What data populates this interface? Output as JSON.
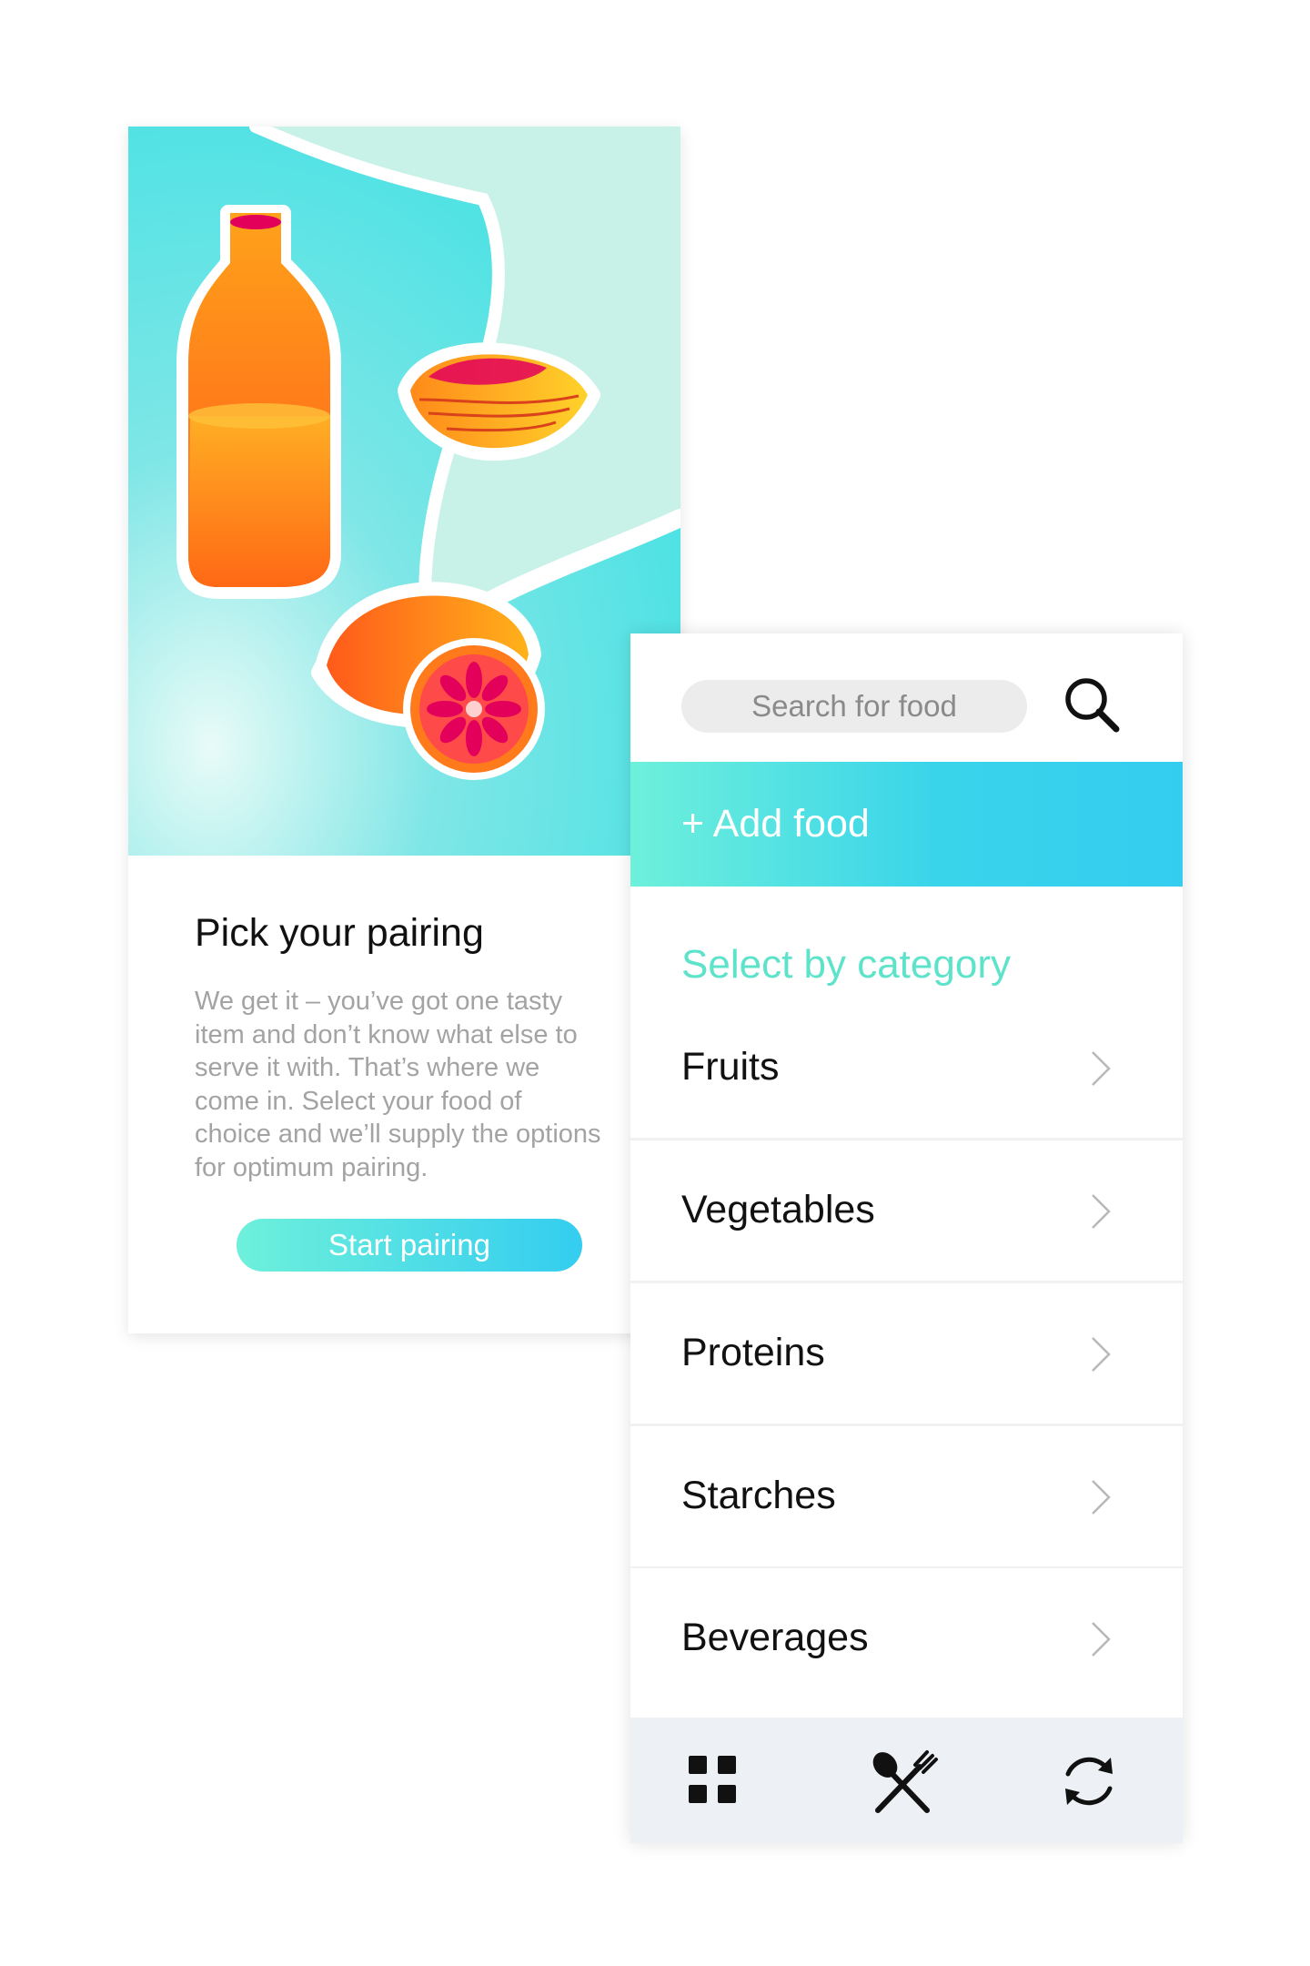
{
  "onboarding": {
    "title": "Pick your pairing",
    "description": "We get it – you’ve got one tasty item and don’t know what else to serve it with. That’s where we come in. Select your food of choice and we’ll supply the options for optimum pairing.",
    "start_button_label": "Start pairing",
    "illustration_icons": [
      "juice-bottle-icon",
      "pastry-icon",
      "blood-orange-icon"
    ]
  },
  "panel": {
    "search": {
      "placeholder": "Search for food",
      "icon": "search-icon"
    },
    "add_food_label": "+ Add food",
    "category_heading": "Select by category",
    "categories": [
      {
        "label": "Fruits"
      },
      {
        "label": "Vegetables"
      },
      {
        "label": "Proteins"
      },
      {
        "label": "Starches"
      },
      {
        "label": "Beverages"
      }
    ],
    "bottom_nav": [
      {
        "icon": "grid-icon"
      },
      {
        "icon": "fork-spoon-icon"
      },
      {
        "icon": "refresh-icon"
      }
    ]
  },
  "colors": {
    "accent_gradient_start": "#6ef0db",
    "accent_gradient_end": "#34cdf0",
    "heading_teal": "#5ee3cb",
    "nav_background": "#edf0f4"
  }
}
